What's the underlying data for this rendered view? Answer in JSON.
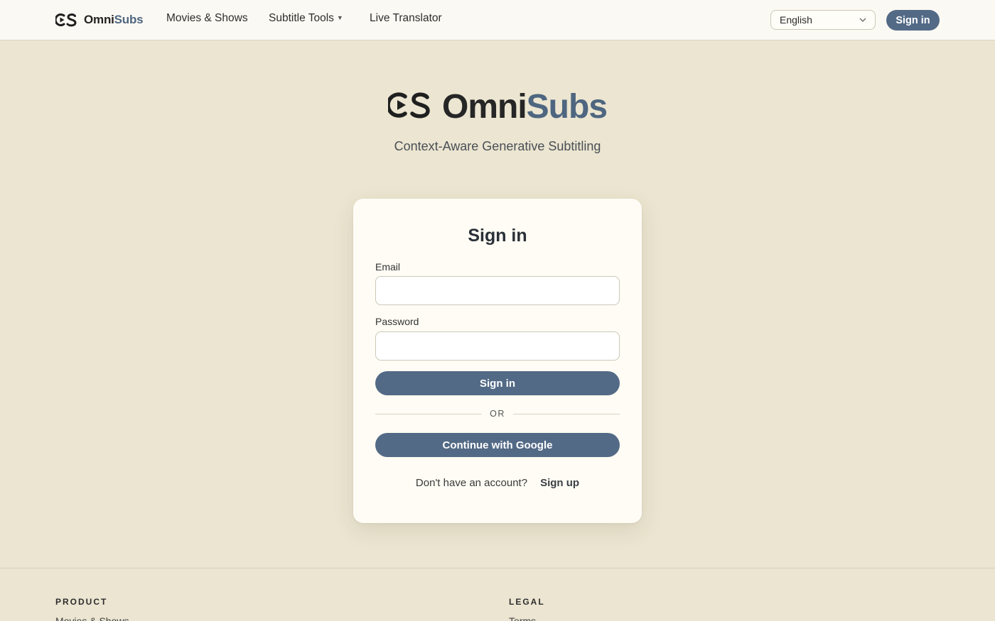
{
  "nav": {
    "brand_omni": "Omni",
    "brand_subs": "Subs",
    "logo_icon": "omnisubs-logo-icon",
    "links": {
      "movies": "Movies & Shows",
      "tools": "Subtitle Tools",
      "live": "Live Translator"
    },
    "language": {
      "selected": "English"
    },
    "signin_label": "Sign in"
  },
  "hero": {
    "brand_omni": "Omni",
    "brand_subs": "Subs",
    "tagline": "Context-Aware Generative Subtitling"
  },
  "signin_card": {
    "title": "Sign in",
    "email_label": "Email",
    "email_value": "",
    "password_label": "Password",
    "password_value": "",
    "submit_label": "Sign in",
    "divider_text": "OR",
    "google_label": "Continue with Google",
    "no_account_text": "Don't have an account?",
    "signup_label": "Sign up"
  },
  "footer": {
    "product_heading": "PRODUCT",
    "legal_heading": "LEGAL",
    "product_links": [
      "Movies & Shows"
    ],
    "legal_links": [
      "Terms"
    ]
  },
  "colors": {
    "accent": "#536a86",
    "brand_subs": "#4e6680",
    "page_bg": "#ebe5d1",
    "card_bg": "#fefcf4"
  }
}
